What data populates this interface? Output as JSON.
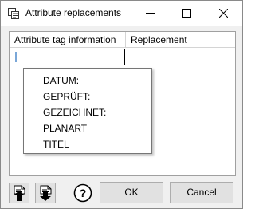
{
  "window": {
    "title": "Attribute replacements"
  },
  "grid": {
    "columns": [
      "Attribute tag information",
      "Replacement"
    ],
    "edit_value": "",
    "replacement_value": ""
  },
  "dropdown": {
    "items": [
      "DATUM:",
      "GEPRÜFT:",
      "GEZEICHNET:",
      "PLANART",
      "TITEL"
    ]
  },
  "buttons": {
    "ok": "OK",
    "cancel": "Cancel"
  },
  "icons": {
    "app": "app-icon",
    "minimize": "minimize-icon",
    "maximize": "maximize-icon",
    "close": "close-icon",
    "import": "import-arrow-up-icon",
    "export": "export-arrow-down-icon",
    "help": "help-icon"
  }
}
